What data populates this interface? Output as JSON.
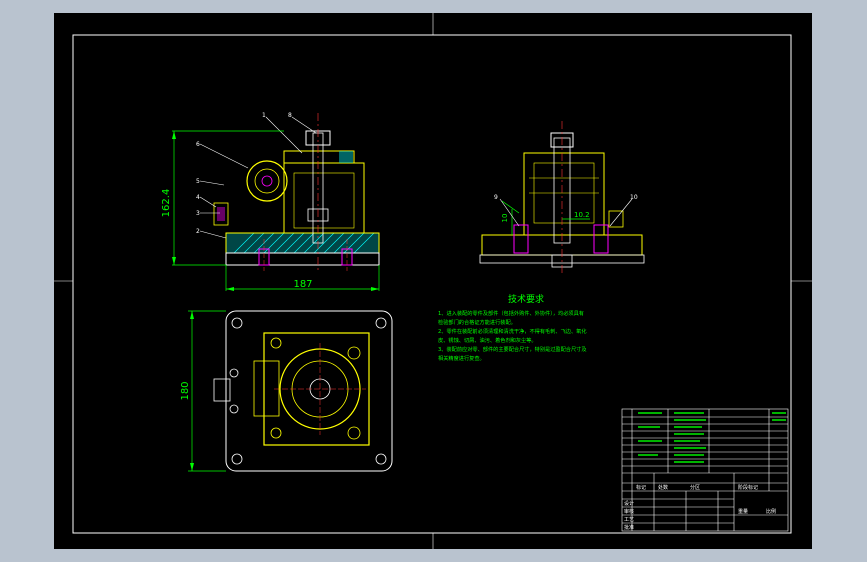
{
  "colors": {
    "background": "#000000",
    "frame": "#ffffff",
    "dimension": "#00ff00",
    "part_outline": "#ffff00",
    "fastener": "#ff00ff",
    "centerline": "#ff3333",
    "section_fill": "#00ffff",
    "table_text": "#00ff00"
  },
  "drawing": {
    "dimensions": {
      "height": "162.4",
      "width": "187",
      "plan_height": "180",
      "side_small": "10",
      "side_mid": "10.2"
    },
    "balloons_front": [
      "1",
      "2",
      "3",
      "4",
      "5",
      "6",
      "8"
    ],
    "balloons_side": [
      "9",
      "10"
    ],
    "notes": {
      "title": "技术要求",
      "lines": [
        "1、进入装配的零件及部件（包括外购件、外协件），均必须具有",
        "检验部门的合格证方能进行装配。",
        "2、零件在装配前必须清理和清洗干净，不得有毛刺、飞边、氧化",
        "皮、锈蚀、切屑、油污、着色剂和灰尘等。",
        "3、装配前应对零、部件的主要配合尺寸，特别是过盈配合尺寸及",
        "相关精度进行复查。"
      ]
    },
    "title_block": {
      "labels": [
        "标记",
        "处数",
        "分区",
        "设计",
        "审核",
        "工艺",
        "批准",
        "阶段标记",
        "重量",
        "比例"
      ]
    }
  }
}
